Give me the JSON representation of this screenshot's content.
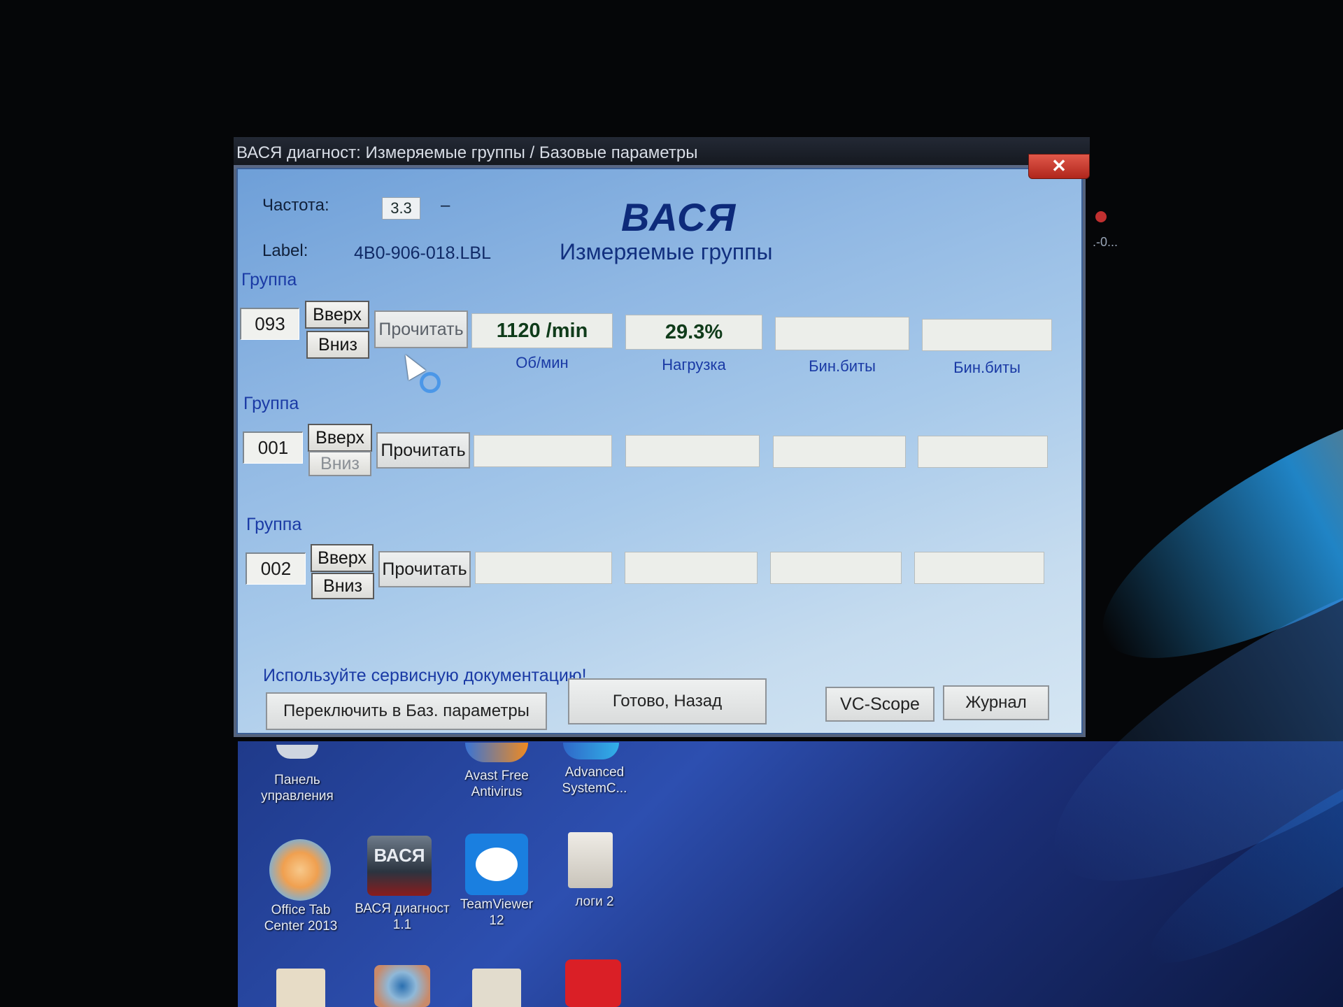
{
  "window": {
    "title": "ВАСЯ диагност: Измеряемые группы / Базовые параметры",
    "close_glyph": "✕"
  },
  "header": {
    "freq_label": "Частота:",
    "freq_value": "3.3",
    "freq_dash": "–",
    "label_label": "Label:",
    "label_value": "4B0-906-018.LBL",
    "brand": "ВАСЯ",
    "subtitle": "Измеряемые группы"
  },
  "groups": [
    {
      "heading": "Группа",
      "number": "093",
      "up_label": "Вверх",
      "down_label": "Вниз",
      "read_label": "Прочитать",
      "values": [
        "1120 /min",
        "29.3%",
        "",
        ""
      ],
      "units": [
        "Об/мин",
        "Нагрузка",
        "Бин.биты",
        "Бин.биты"
      ]
    },
    {
      "heading": "Группа",
      "number": "001",
      "up_label": "Вверх",
      "down_label": "Вниз",
      "read_label": "Прочитать",
      "values": [
        "",
        "",
        "",
        ""
      ]
    },
    {
      "heading": "Группа",
      "number": "002",
      "up_label": "Вверх",
      "down_label": "Вниз",
      "read_label": "Прочитать",
      "values": [
        "",
        "",
        "",
        ""
      ]
    }
  ],
  "footer": {
    "hint": "Используйте сервисную документацию!",
    "switch_label": "Переключить в Баз. параметры",
    "done_label": "Готово, Назад",
    "scope_label": "VC-Scope",
    "journal_label": "Журнал"
  },
  "desktop": {
    "icons": [
      {
        "label": "Панель управления"
      },
      {
        "label": "Avast Free Antivirus"
      },
      {
        "label": "Advanced SystemC..."
      },
      {
        "label": "Office Tab Center 2013"
      },
      {
        "label": "ВАСЯ диагност 1.1"
      },
      {
        "label": "TeamViewer 12"
      },
      {
        "label": "логи 2"
      }
    ],
    "vasya_icon_text": "ВАСЯ",
    "side_text": ".-0..."
  },
  "colors": {
    "accent_blue": "#1a3aa5",
    "value_green": "#0f3b1a",
    "close_red": "#c0392b"
  }
}
